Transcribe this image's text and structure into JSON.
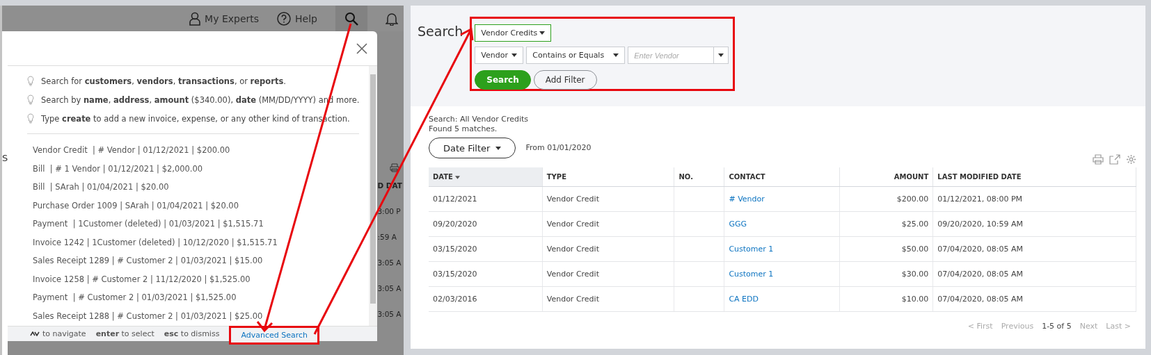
{
  "top_bar": {
    "items": [
      {
        "kind": "experts",
        "label": "My Experts"
      },
      {
        "kind": "help",
        "label": "Help"
      }
    ]
  },
  "background_page": {
    "left_fragment": "S",
    "column_fragment": "D DAT",
    "time_fragments": [
      "3:00 P",
      ":59 A",
      "3:05 A",
      "3:05 A",
      "3:05 A"
    ]
  },
  "search_popup": {
    "tips": [
      "Search for **customers**, **vendors**, **transactions**, or **reports**.",
      "Search by **name**, **address**, **amount** ($340.00), **date** (MM/DD/YYYY) and more.",
      "Type **create** to add a new invoice, expense, or any other kind of transaction."
    ],
    "results": [
      "Vendor Credit  | # Vendor | 01/12/2021 | $200.00",
      "Bill  | # 1 Vendor | 01/12/2021 | $2,000.00",
      "Bill  | SArah | 01/04/2021 | $20.00",
      "Purchase Order 1009 | SArah | 01/04/2021 | $20.00",
      "Payment  | 1Customer (deleted) | 01/03/2021 | $1,515.71",
      "Invoice 1242 | 1Customer (deleted) | 10/12/2020 | $1,515.71",
      "Sales Receipt 1289 | # Customer 2 | 01/03/2021 | $15.00",
      "Invoice 1258 | # Customer 2 | 11/12/2020 | $1,525.00",
      "Payment  | # Customer 2 | 01/03/2021 | $1,525.00",
      "Sales Receipt 1288 | # Customer 2 | 01/03/2021 | $25.00"
    ],
    "footer": {
      "hints": [
        {
          "kind": "arrows",
          "text": "to navigate"
        },
        {
          "kind": "text",
          "text": "**enter** to select"
        },
        {
          "kind": "text",
          "text": "**esc** to dismiss"
        }
      ],
      "advanced_search": "Advanced Search"
    }
  },
  "advanced_search": {
    "title": "Search",
    "type_select": "Vendor Credits",
    "filters": [
      {
        "kind": "select",
        "value": "Vendor"
      },
      {
        "kind": "select",
        "value": "Contains or Equals"
      },
      {
        "kind": "input",
        "placeholder": "Enter Vendor"
      }
    ],
    "buttons": [
      {
        "kind": "primary",
        "label": "Search"
      },
      {
        "kind": "secondary",
        "label": "Add Filter"
      }
    ]
  },
  "results": {
    "summary": "Search: All Vendor Credits",
    "count": "Found 5 matches.",
    "date_filter": "Date Filter",
    "date_range": "From 01/01/2020",
    "table": {
      "columns": [
        {
          "label": "DATE",
          "sorted": true,
          "kind": "text"
        },
        {
          "label": "TYPE",
          "sorted": false,
          "kind": "text"
        },
        {
          "label": "NO.",
          "sorted": false,
          "kind": "text"
        },
        {
          "label": "CONTACT",
          "sorted": false,
          "kind": "link"
        },
        {
          "label": "AMOUNT",
          "sorted": false,
          "kind": "amount"
        },
        {
          "label": "LAST MODIFIED DATE",
          "sorted": false,
          "kind": "text"
        }
      ],
      "rows": [
        [
          "01/12/2021",
          "Vendor Credit",
          "",
          "# Vendor",
          "$200.00",
          "01/12/2021, 08:00 PM"
        ],
        [
          "09/20/2020",
          "Vendor Credit",
          "",
          "GGG",
          "$25.00",
          "09/20/2020, 10:59 AM"
        ],
        [
          "03/15/2020",
          "Vendor Credit",
          "",
          "Customer 1",
          "$50.00",
          "07/04/2020, 08:05 AM"
        ],
        [
          "03/15/2020",
          "Vendor Credit",
          "",
          "Customer 1",
          "$30.00",
          "07/04/2020, 08:05 AM"
        ],
        [
          "02/03/2016",
          "Vendor Credit",
          "",
          "CA EDD",
          "$10.00",
          "07/04/2020, 08:05 AM"
        ]
      ]
    },
    "pagination": [
      {
        "label": "< First",
        "disabled": true
      },
      {
        "label": "Previous",
        "disabled": true
      },
      {
        "label": "1-5 of 5",
        "disabled": false
      },
      {
        "label": "Next",
        "disabled": true
      },
      {
        "label": "Last >",
        "disabled": true
      }
    ]
  }
}
